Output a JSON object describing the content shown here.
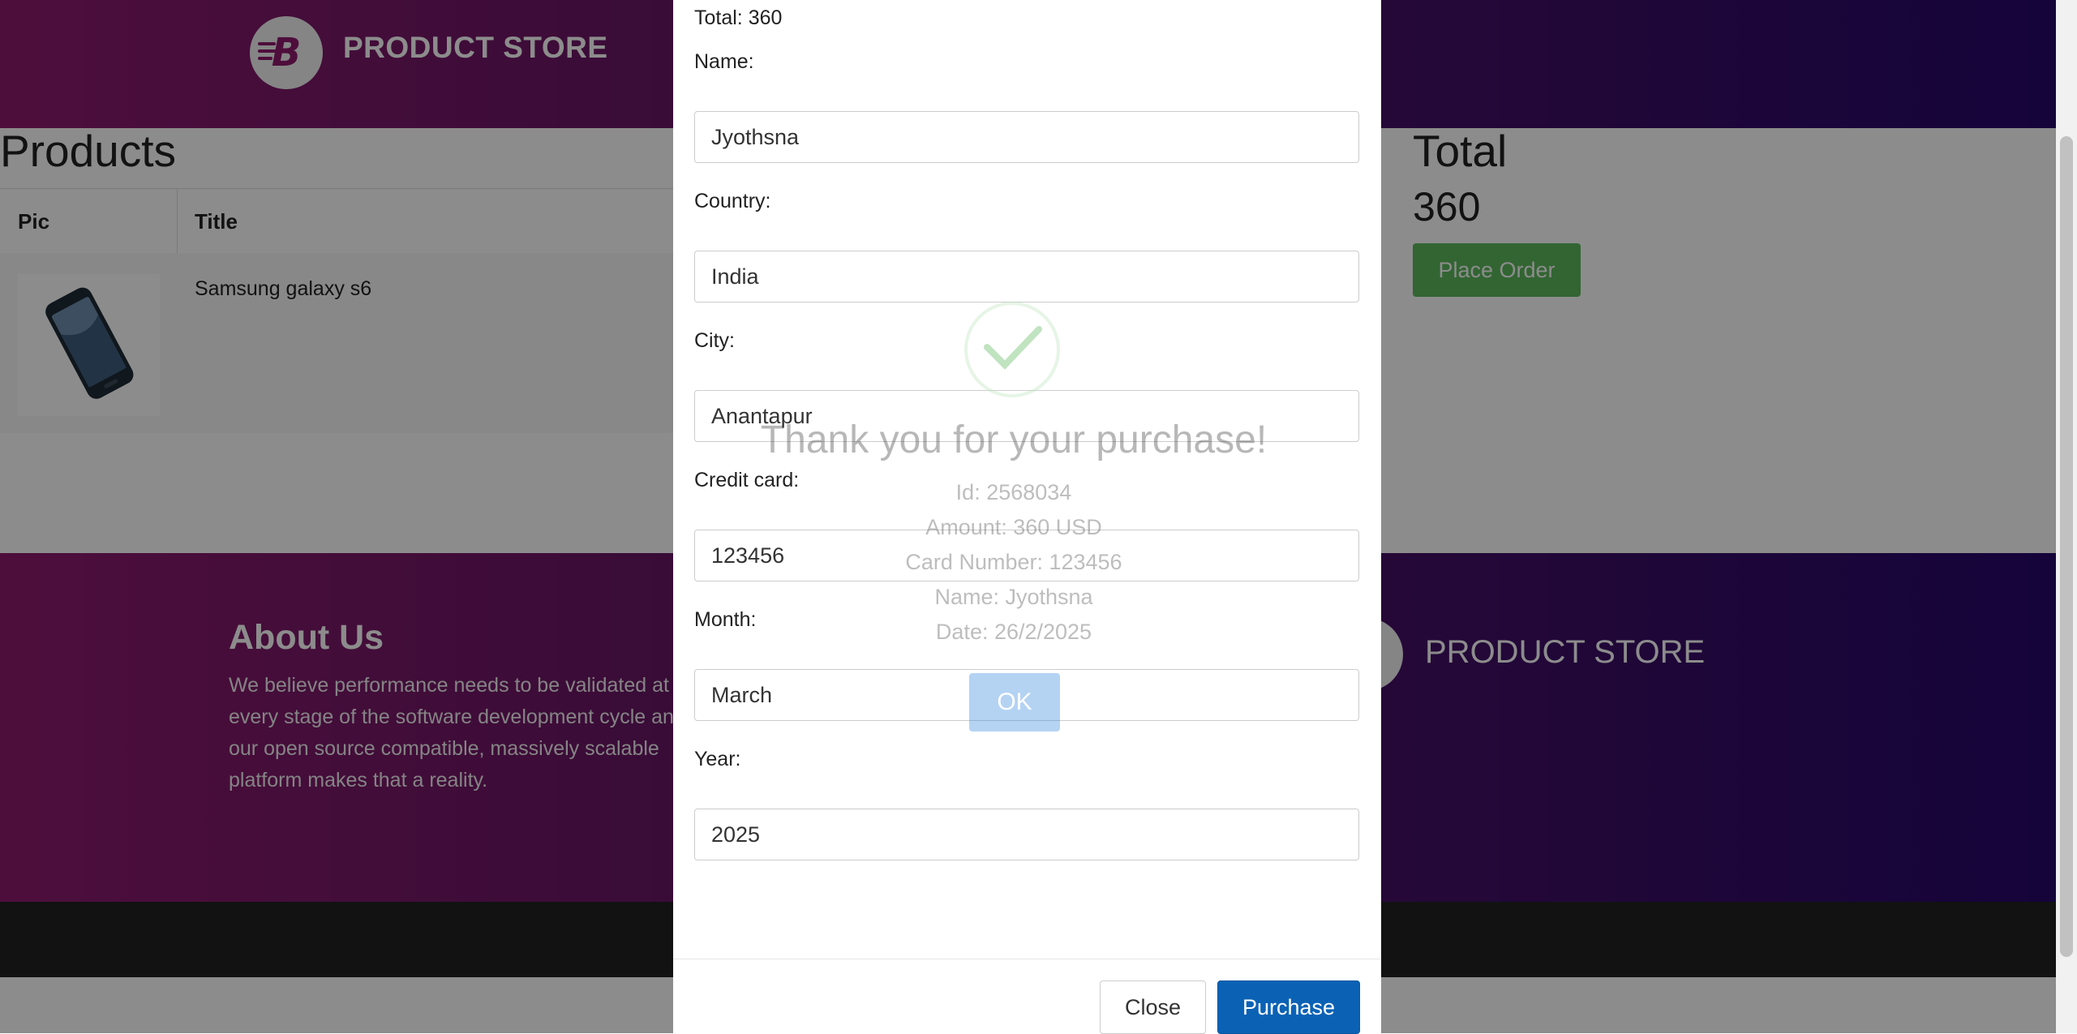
{
  "navbar": {
    "brand_letter": "B",
    "brand_name": "PRODUCT STORE"
  },
  "products": {
    "title": "Products",
    "columns": [
      "Pic",
      "Title"
    ],
    "rows": [
      {
        "title": "Samsung galaxy s6"
      }
    ]
  },
  "cart_total": {
    "title": "Total",
    "value": "360",
    "place_order_label": "Place Order"
  },
  "footer": {
    "about_title": "About Us",
    "about_text": "We believe performance needs to be validated at every stage of the software development cycle and our open source compatible, massively scalable platform makes that a reality.",
    "brand_letter": "B",
    "brand_name": "PRODUCT STORE"
  },
  "order_modal": {
    "total_label": "Total: 360",
    "fields": {
      "name": {
        "label": "Name:",
        "value": "Jyothsna"
      },
      "country": {
        "label": "Country:",
        "value": "India"
      },
      "city": {
        "label": "City:",
        "value": "Anantapur"
      },
      "card": {
        "label": "Credit card:",
        "value": "123456"
      },
      "month": {
        "label": "Month:",
        "value": "March"
      },
      "year": {
        "label": "Year:",
        "value": "2025"
      }
    },
    "close_label": "Close",
    "purchase_label": "Purchase"
  },
  "confirmation": {
    "icon": "checkmark-icon",
    "title": "Thank you for your purchase!",
    "lines": [
      "Id: 2568034",
      "Amount: 360 USD",
      "Card Number: 123456",
      "Name: Jyothsna",
      "Date: 26/2/2025"
    ],
    "ok_label": "OK"
  },
  "colors": {
    "brand_start": "#8e1a6e",
    "brand_end": "#26086a",
    "purchase": "#0b62b5",
    "place_order": "#5cb85c",
    "ok": "#3d8ee0"
  }
}
